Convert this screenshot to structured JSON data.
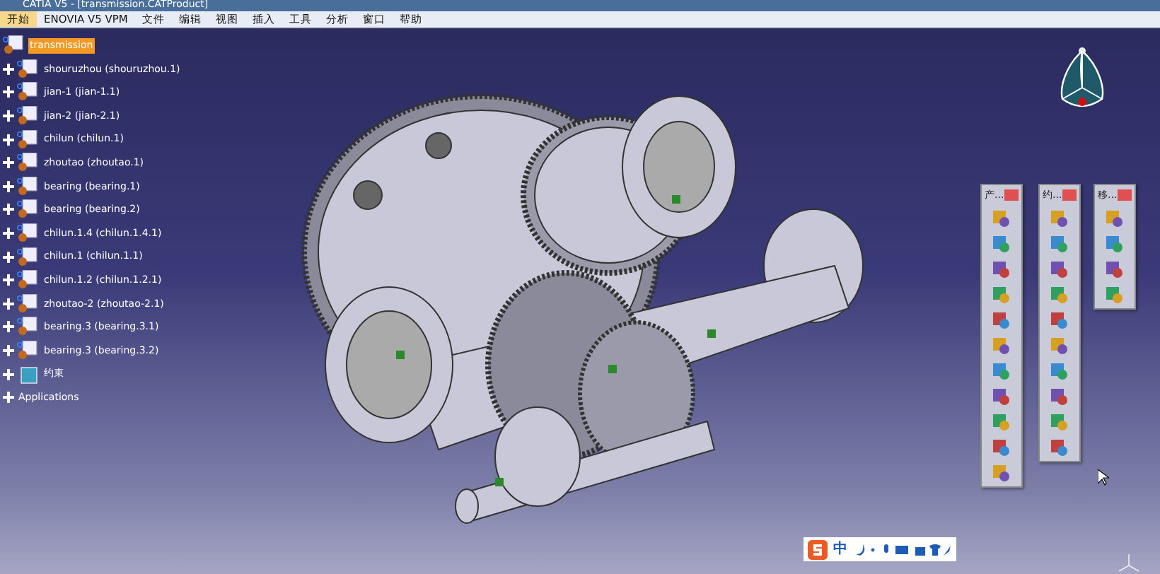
{
  "window": {
    "title": "CATIA V5 - [transmission.CATProduct]"
  },
  "menu": [
    {
      "label": "开始",
      "selected": true
    },
    {
      "label": "ENOVIA V5 VPM",
      "selected": false
    },
    {
      "label": "文件",
      "selected": false
    },
    {
      "label": "编辑",
      "selected": false
    },
    {
      "label": "视图",
      "selected": false
    },
    {
      "label": "插入",
      "selected": false
    },
    {
      "label": "工具",
      "selected": false
    },
    {
      "label": "分析",
      "selected": false
    },
    {
      "label": "窗口",
      "selected": false
    },
    {
      "label": "帮助",
      "selected": false
    }
  ],
  "tree": {
    "root": {
      "label": "transmission",
      "selected": true
    },
    "children": [
      {
        "label": "shouruzhou (shouruzhou.1)",
        "kind": "part"
      },
      {
        "label": "jian-1 (jian-1.1)",
        "kind": "part"
      },
      {
        "label": "jian-2 (jian-2.1)",
        "kind": "part"
      },
      {
        "label": "chilun (chilun.1)",
        "kind": "part"
      },
      {
        "label": "zhoutao (zhoutao.1)",
        "kind": "part"
      },
      {
        "label": "bearing (bearing.1)",
        "kind": "part"
      },
      {
        "label": "bearing (bearing.2)",
        "kind": "part"
      },
      {
        "label": "chilun.1.4 (chilun.1.4.1)",
        "kind": "part"
      },
      {
        "label": "chilun.1 (chilun.1.1)",
        "kind": "part"
      },
      {
        "label": "chilun.1.2 (chilun.1.2.1)",
        "kind": "part"
      },
      {
        "label": "zhoutao-2 (zhoutao-2.1)",
        "kind": "part"
      },
      {
        "label": "bearing.3 (bearing.3.1)",
        "kind": "part"
      },
      {
        "label": "bearing.3 (bearing.3.2)",
        "kind": "part"
      },
      {
        "label": "约束",
        "kind": "constraints"
      },
      {
        "label": "Applications",
        "kind": "applications"
      }
    ]
  },
  "toolbars": [
    {
      "title": "产..."
    },
    {
      "title": "约..."
    },
    {
      "title": "移..."
    }
  ],
  "ime_bar": {
    "mode": "中"
  }
}
